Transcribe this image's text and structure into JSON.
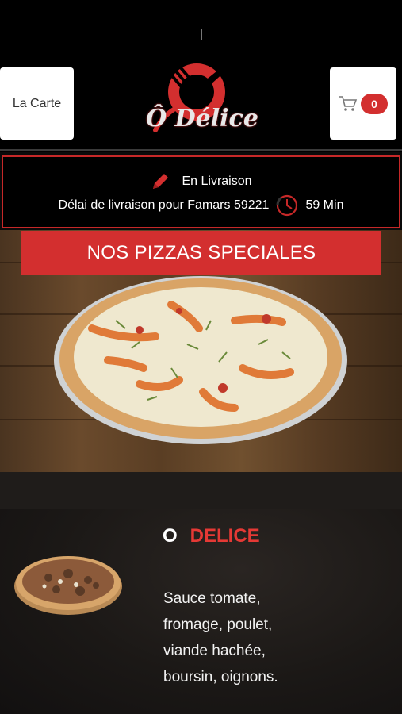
{
  "header": {
    "menu_button": "La Carte",
    "cart_count": "0",
    "logo_text": "Ô Délice",
    "brand_color": "#d32f2f"
  },
  "delivery": {
    "mode": "En Livraison",
    "delay_label": "Délai de livraison pour Famars 59221",
    "delay_value": "59 Min",
    "icons": {
      "mode": "pencil-icon",
      "delay": "clock-icon"
    }
  },
  "banner": {
    "title": "NOS PIZZAS SPECIALES"
  },
  "product": {
    "name_prefix": "O",
    "name": "DELICE",
    "description_lines": [
      "Sauce tomate,",
      "fromage, poulet,",
      "viande hachée,",
      "boursin, oignons."
    ]
  },
  "colors": {
    "accent": "#d32f2f",
    "title_red": "#e53935",
    "background": "#0a0a0a"
  }
}
